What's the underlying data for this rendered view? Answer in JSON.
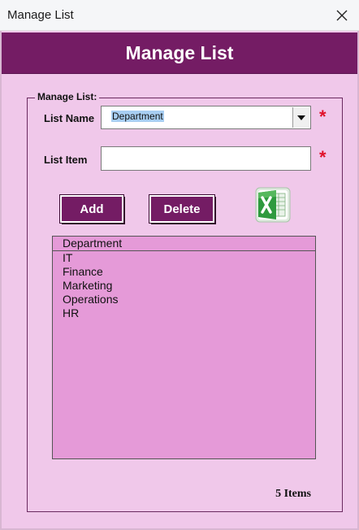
{
  "window": {
    "title": "Manage List",
    "close_icon": "close-icon"
  },
  "header": {
    "title": "Manage List",
    "bg_color": "#741c64"
  },
  "group": {
    "legend": "Manage List:"
  },
  "fields": {
    "list_name_label": "List Name",
    "list_name_value": "Department",
    "list_item_label": "List Item",
    "list_item_value": "",
    "required_mark": "*"
  },
  "buttons": {
    "add": "Add",
    "delete": "Delete",
    "export_icon": "excel-icon"
  },
  "list": {
    "header": "Department",
    "items": [
      "IT",
      "Finance",
      "Marketing",
      "Operations",
      "HR"
    ]
  },
  "status": {
    "count": "5 Items"
  },
  "colors": {
    "accent": "#741c64",
    "background": "#f0c8ea",
    "list_bg": "#e59ad8",
    "required": "#e0122a"
  }
}
